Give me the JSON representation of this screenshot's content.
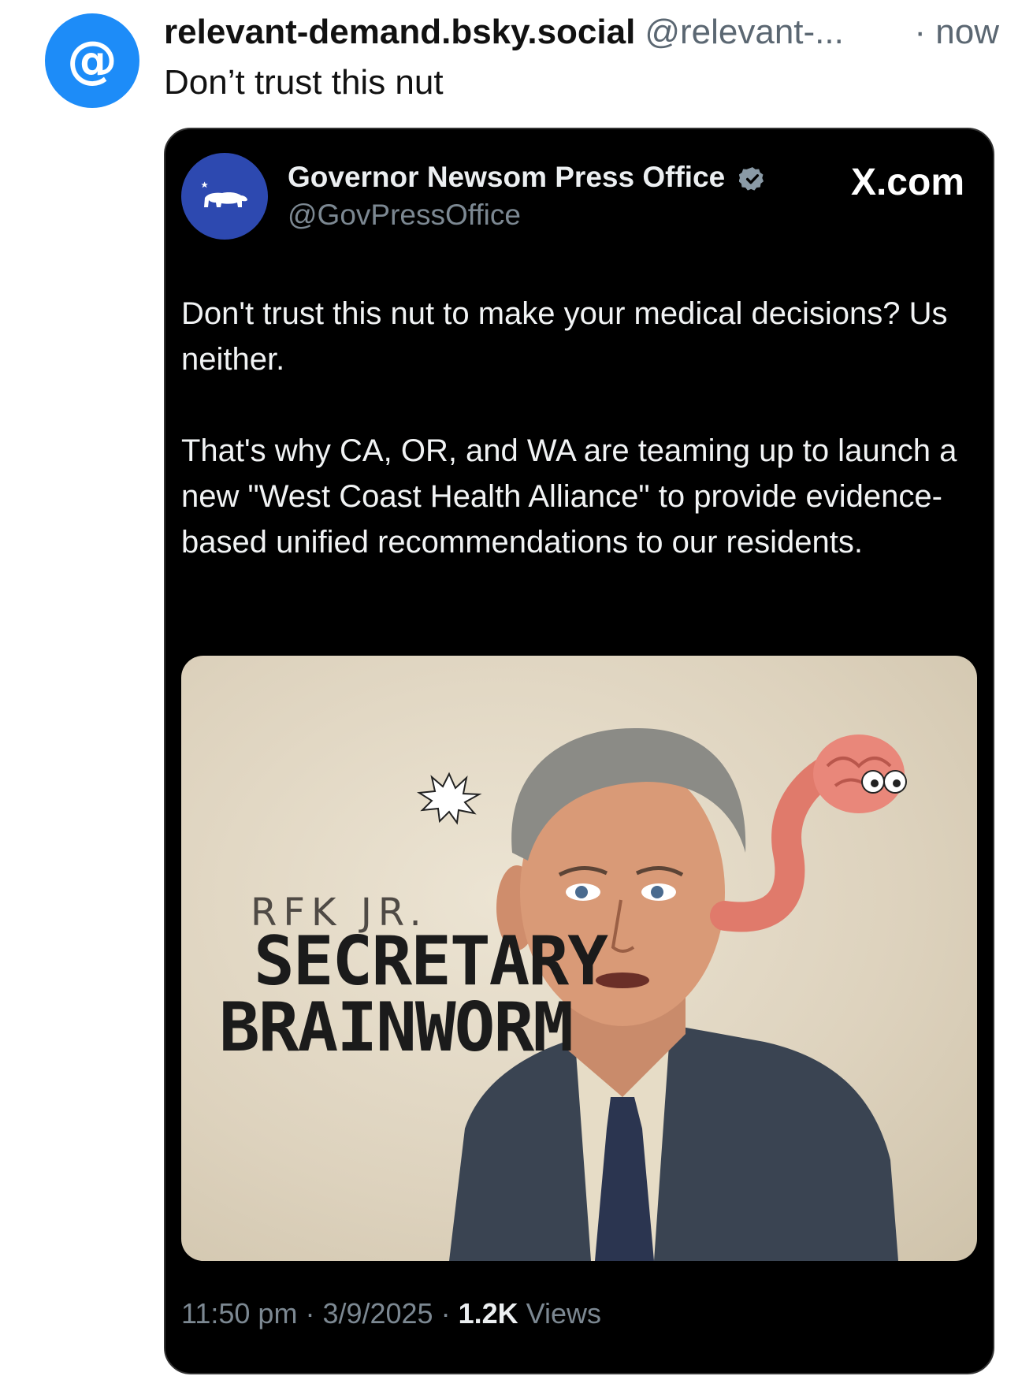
{
  "post": {
    "avatar_symbol": "@",
    "display_name": "relevant-demand.bsky.social",
    "handle": "@relevant-...",
    "time": "· now",
    "text": "Don’t trust this nut"
  },
  "embed": {
    "name": "Governor Newsom Press Office",
    "handle": "@GovPressOffice",
    "source": "X.com",
    "body_p1": "Don't trust this nut to make your medical decisions? Us neither.",
    "body_p2": "That's why CA, OR, and WA are teaming up to launch a new \"West Coast Health Alliance\" to provide evidence-based unified recommendations to our residents.",
    "image": {
      "subtitle": "RFK JR.",
      "title_line1": "SECRETARY",
      "title_line2": "BRAINWORM"
    },
    "footer": {
      "time": "11:50 pm",
      "date": "3/9/2025",
      "views_count": "1.2K",
      "views_label": "Views"
    }
  },
  "colors": {
    "avatar_bg": "#1d8cf8",
    "embed_bg": "#000000",
    "embed_avatar_bg": "#2d49b0",
    "verified": "#8a9aa6"
  },
  "icons": [
    "at-symbol-avatar-icon",
    "california-bear-logo-icon",
    "verified-badge-icon"
  ]
}
